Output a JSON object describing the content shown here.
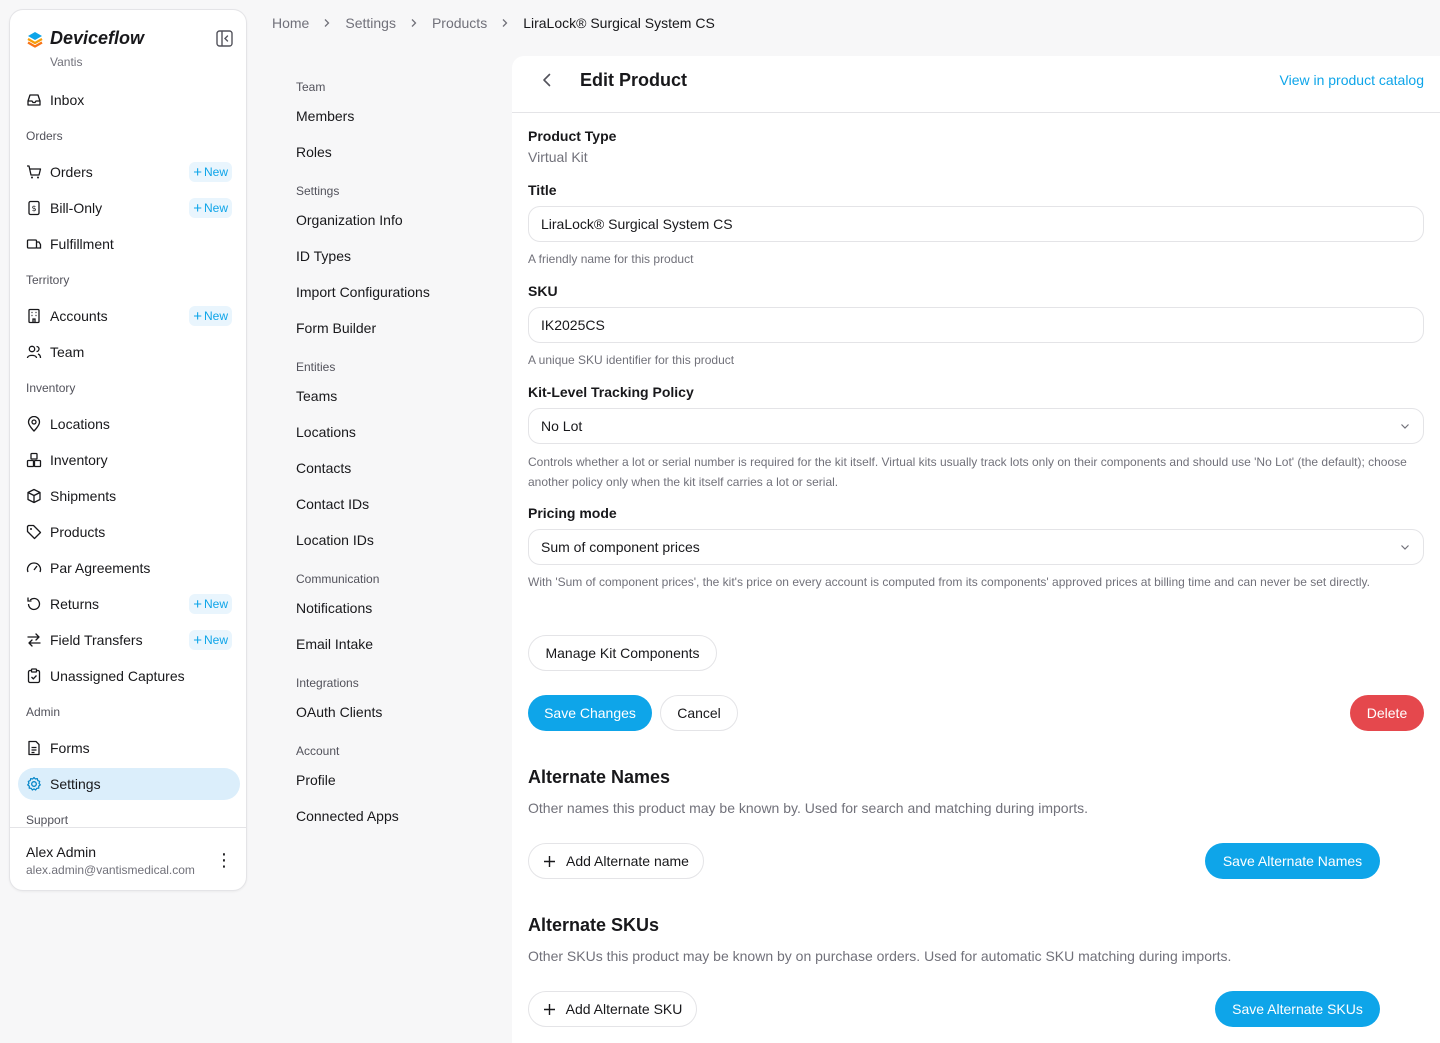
{
  "app": {
    "name": "Deviceflow",
    "org": "Vantis"
  },
  "sidebar": {
    "inbox": "Inbox",
    "sections": {
      "orders": "Orders",
      "territory": "Territory",
      "inventory": "Inventory",
      "admin": "Admin",
      "support": "Support"
    },
    "items": {
      "orders": "Orders",
      "bill_only": "Bill-Only",
      "fulfillment": "Fulfillment",
      "accounts": "Accounts",
      "team": "Team",
      "locations": "Locations",
      "inventory": "Inventory",
      "shipments": "Shipments",
      "products": "Products",
      "par_agreements": "Par Agreements",
      "returns": "Returns",
      "field_transfers": "Field Transfers",
      "unassigned_captures": "Unassigned Captures",
      "forms": "Forms",
      "settings": "Settings"
    },
    "new_label": "New",
    "user": {
      "name": "Alex Admin",
      "email": "alex.admin@vantismedical.com"
    }
  },
  "breadcrumb": [
    "Home",
    "Settings",
    "Products",
    "LiraLock® Surgical System CS"
  ],
  "settings_nav": {
    "sections": {
      "team": "Team",
      "settings": "Settings",
      "entities": "Entities",
      "communication": "Communication",
      "integrations": "Integrations",
      "account": "Account"
    },
    "items": {
      "members": "Members",
      "roles": "Roles",
      "organization_info": "Organization Info",
      "id_types": "ID Types",
      "import_configurations": "Import Configurations",
      "form_builder": "Form Builder",
      "teams": "Teams",
      "locations": "Locations",
      "contacts": "Contacts",
      "contact_ids": "Contact IDs",
      "location_ids": "Location IDs",
      "notifications": "Notifications",
      "email_intake": "Email Intake",
      "oauth_clients": "OAuth Clients",
      "profile": "Profile",
      "connected_apps": "Connected Apps"
    }
  },
  "main": {
    "title": "Edit Product",
    "catalog_link": "View in product catalog",
    "product_type": {
      "label": "Product Type",
      "value": "Virtual Kit"
    },
    "title_field": {
      "label": "Title",
      "value": "LiraLock® Surgical System CS",
      "help": "A friendly name for this product"
    },
    "sku": {
      "label": "SKU",
      "value": "IK2025CS",
      "help": "A unique SKU identifier for this product"
    },
    "tracking": {
      "label": "Kit-Level Tracking Policy",
      "value": "No Lot",
      "help": "Controls whether a lot or serial number is required for the kit itself. Virtual kits usually track lots only on their components and should use 'No Lot' (the default); choose another policy only when the kit itself carries a lot or serial."
    },
    "pricing": {
      "label": "Pricing mode",
      "value": "Sum of component prices",
      "help": "With 'Sum of component prices', the kit's price on every account is computed from its components' approved prices at billing time and can never be set directly."
    },
    "manage_components": "Manage Kit Components",
    "save": "Save Changes",
    "cancel": "Cancel",
    "delete": "Delete",
    "alt_names": {
      "title": "Alternate Names",
      "desc": "Other names this product may be known by. Used for search and matching during imports.",
      "add": "Add Alternate name",
      "save": "Save Alternate Names"
    },
    "alt_skus": {
      "title": "Alternate SKUs",
      "desc": "Other SKUs this product may be known by on purchase orders. Used for automatic SKU matching during imports.",
      "add": "Add Alternate SKU",
      "save": "Save Alternate SKUs"
    }
  },
  "colors": {
    "accent": "#0ea5e9",
    "danger": "#e5484d",
    "active_bg": "#dbeefb"
  }
}
